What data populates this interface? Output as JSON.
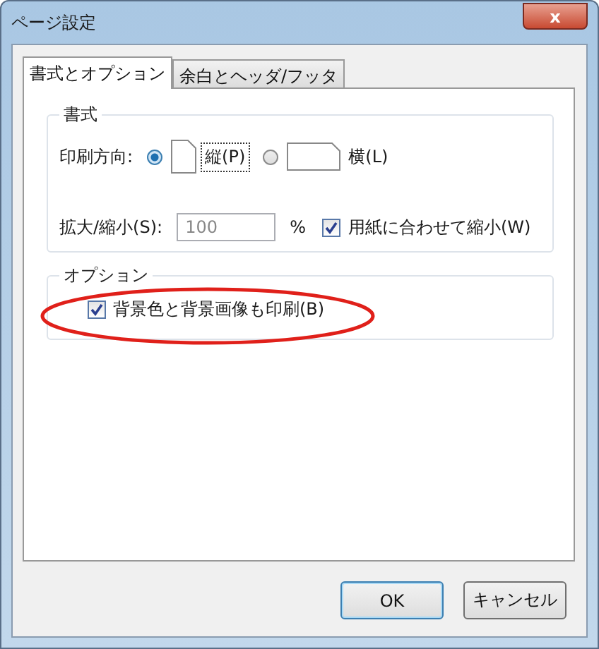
{
  "window": {
    "title": "ページ設定",
    "close": "x"
  },
  "tabs": [
    {
      "label": "書式とオプション",
      "selected": true
    },
    {
      "label": "余白とヘッダ/フッタ",
      "selected": false
    }
  ],
  "format_group": {
    "title": "書式",
    "orientation_label": "印刷方向:",
    "orientations": [
      {
        "label": "縦(P)",
        "kind": "portrait",
        "selected": true
      },
      {
        "label": "横(L)",
        "kind": "landscape",
        "selected": false
      }
    ],
    "scale_label": "拡大/縮小(S):",
    "scale_value": "100",
    "percent": "%",
    "shrink_to_fit": {
      "label": "用紙に合わせて縮小(W)",
      "checked": true
    }
  },
  "options_group": {
    "title": "オプション",
    "print_background": {
      "label": "背景色と背景画像も印刷(B)",
      "checked": true
    }
  },
  "buttons": [
    "OK",
    "キャンセル"
  ]
}
